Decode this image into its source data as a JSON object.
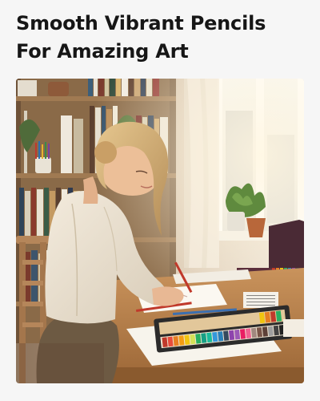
{
  "product": {
    "headline_line1": "Smooth Vibrant Pencils",
    "headline_line2": "For Amazing Art"
  },
  "image": {
    "alt": "Woman drawing with colored pencils at a wooden desk"
  }
}
